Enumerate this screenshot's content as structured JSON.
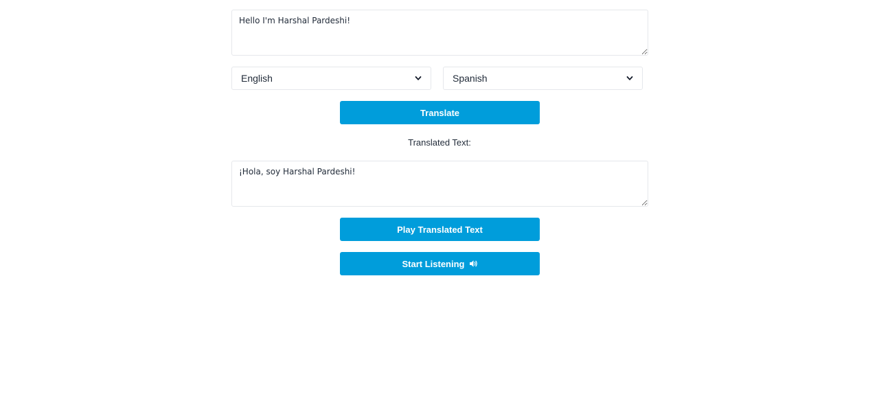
{
  "source": {
    "value": "Hello I'm Harshal Pardeshi!"
  },
  "languages": {
    "from": "English",
    "to": "Spanish"
  },
  "buttons": {
    "translate": "Translate",
    "play": "Play Translated Text",
    "listen": "Start Listening"
  },
  "result": {
    "heading": "Translated Text:",
    "value": "¡Hola, soy Harshal Pardeshi!"
  },
  "icons": {
    "dropdown": "chevron-down-icon",
    "listen": "speaker-icon"
  },
  "colors": {
    "accent": "#009ddb",
    "button_text": "#ffffff",
    "border": "#e5e7eb"
  }
}
